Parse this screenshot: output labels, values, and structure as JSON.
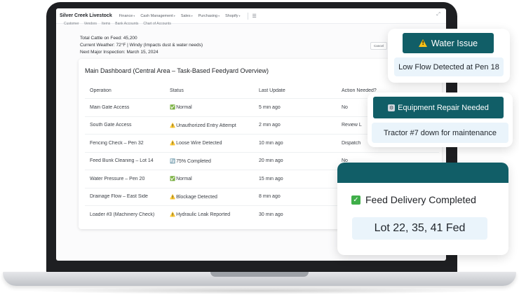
{
  "app": {
    "brand": "Silver Creek Livestock",
    "nav": [
      "Finance",
      "Cash Management",
      "Sales",
      "Purchasing",
      "Shopify"
    ],
    "subnav": [
      "Customer",
      "Vendors",
      "Items",
      "Bank Accounts",
      "Chart of Accounts"
    ],
    "cancel_label": "Cancel"
  },
  "summary": {
    "cattle": "Total Cattle on Feed: 45,200",
    "weather": "Current Weather: 72°F | Windy (Impacts dust & water needs)",
    "inspection": "Next Major Inspection: March 15, 2024"
  },
  "dashboard": {
    "title": "Main Dashboard (Central Area – Task-Based Feedyard Overview)",
    "columns": [
      "Operation",
      "Status",
      "Last Update",
      "Action Needed?"
    ],
    "rows": [
      {
        "operation": "Main Gate Access",
        "status_icon": "✅",
        "status": "Normal",
        "update": "5 min ago",
        "action": "No"
      },
      {
        "operation": "South Gate Access",
        "status_icon": "⚠️",
        "status": "Unauthorized Entry Attempt",
        "update": "2 min ago",
        "action": "Review L"
      },
      {
        "operation": "Fencing Check – Pen 32",
        "status_icon": "⚠️",
        "status": "Loose Wire Detected",
        "update": "10 min ago",
        "action": "Dispatch"
      },
      {
        "operation": "Feed Bunk Cleaning – Lot 14",
        "status_icon": "🔄",
        "status": "75% Completed",
        "update": "20 min ago",
        "action": "No"
      },
      {
        "operation": "Water Pressure – Pen 20",
        "status_icon": "✅",
        "status": "Normal",
        "update": "15 min ago",
        "action": ""
      },
      {
        "operation": "Drainage Flow – East Side",
        "status_icon": "⚠️",
        "status": "Blockage Detected",
        "update": "8 min ago",
        "action": ""
      },
      {
        "operation": "Loader #3 (Machinery Check)",
        "status_icon": "⚠️",
        "status": "Hydraulic Leak Reported",
        "update": "30 min ago",
        "action": ""
      }
    ]
  },
  "alerts": {
    "water": {
      "title": "Water Issue",
      "detail": "Low Flow Detected at Pen 18"
    },
    "equipment": {
      "title": "Equipment Repair Needed",
      "detail": "Tractor #7 down for maintenance"
    },
    "feed": {
      "title": "Feed Delivery Completed",
      "detail": "Lot 22, 35, 41 Fed"
    }
  },
  "colors": {
    "teal": "#115e67",
    "pill": "#eaf4fb",
    "check": "#3fae49",
    "warn": "#f6c019"
  }
}
